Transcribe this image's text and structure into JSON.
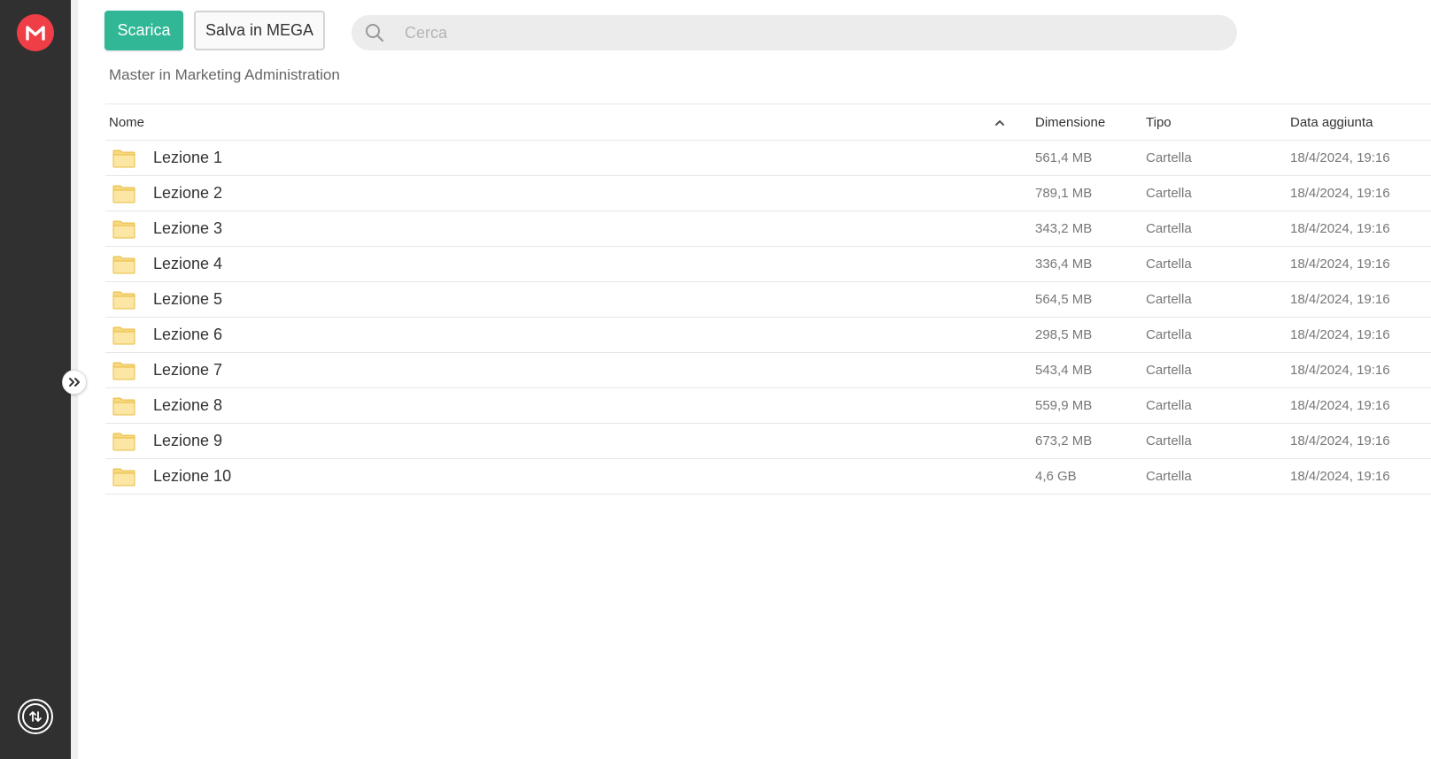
{
  "sidebar": {
    "logo_icon": "mega-logo-icon",
    "logo_color": "#ef3e45",
    "transfer_icon": "transfer-icon"
  },
  "toolbar": {
    "download_label": "Scarica",
    "save_label": "Salva in MEGA",
    "accent_color": "#31b796"
  },
  "search": {
    "placeholder": "Cerca",
    "value": ""
  },
  "breadcrumb": "Master in Marketing Administration",
  "table": {
    "columns": {
      "name": "Nome",
      "size": "Dimensione",
      "type": "Tipo",
      "date": "Data aggiunta"
    },
    "sort": "name-ascending",
    "rows": [
      {
        "name": "Lezione 1",
        "size": "561,4 MB",
        "type": "Cartella",
        "date": "18/4/2024, 19:16"
      },
      {
        "name": "Lezione 2",
        "size": "789,1 MB",
        "type": "Cartella",
        "date": "18/4/2024, 19:16"
      },
      {
        "name": "Lezione 3",
        "size": "343,2 MB",
        "type": "Cartella",
        "date": "18/4/2024, 19:16"
      },
      {
        "name": "Lezione 4",
        "size": "336,4 MB",
        "type": "Cartella",
        "date": "18/4/2024, 19:16"
      },
      {
        "name": "Lezione 5",
        "size": "564,5 MB",
        "type": "Cartella",
        "date": "18/4/2024, 19:16"
      },
      {
        "name": "Lezione 6",
        "size": "298,5 MB",
        "type": "Cartella",
        "date": "18/4/2024, 19:16"
      },
      {
        "name": "Lezione 7",
        "size": "543,4 MB",
        "type": "Cartella",
        "date": "18/4/2024, 19:16"
      },
      {
        "name": "Lezione 8",
        "size": "559,9 MB",
        "type": "Cartella",
        "date": "18/4/2024, 19:16"
      },
      {
        "name": "Lezione 9",
        "size": "673,2 MB",
        "type": "Cartella",
        "date": "18/4/2024, 19:16"
      },
      {
        "name": "Lezione 10",
        "size": "4,6 GB",
        "type": "Cartella",
        "date": "18/4/2024, 19:16"
      }
    ]
  }
}
